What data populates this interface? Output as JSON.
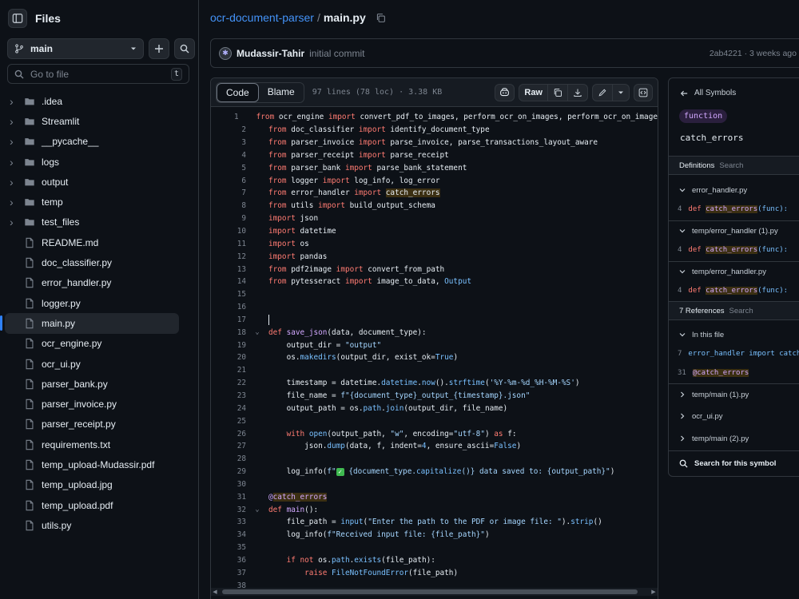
{
  "sidebar": {
    "title": "Files",
    "branch": "main",
    "goto_placeholder": "Go to file",
    "goto_kbd": "t",
    "items": [
      {
        "label": ".idea",
        "type": "folder"
      },
      {
        "label": "Streamlit",
        "type": "folder"
      },
      {
        "label": "__pycache__",
        "type": "folder"
      },
      {
        "label": "logs",
        "type": "folder"
      },
      {
        "label": "output",
        "type": "folder"
      },
      {
        "label": "temp",
        "type": "folder"
      },
      {
        "label": "test_files",
        "type": "folder"
      },
      {
        "label": "README.md",
        "type": "file"
      },
      {
        "label": "doc_classifier.py",
        "type": "file"
      },
      {
        "label": "error_handler.py",
        "type": "file"
      },
      {
        "label": "logger.py",
        "type": "file"
      },
      {
        "label": "main.py",
        "type": "file",
        "active": true
      },
      {
        "label": "ocr_engine.py",
        "type": "file"
      },
      {
        "label": "ocr_ui.py",
        "type": "file"
      },
      {
        "label": "parser_bank.py",
        "type": "file"
      },
      {
        "label": "parser_invoice.py",
        "type": "file"
      },
      {
        "label": "parser_receipt.py",
        "type": "file"
      },
      {
        "label": "requirements.txt",
        "type": "file"
      },
      {
        "label": "temp_upload-Mudassir.pdf",
        "type": "file"
      },
      {
        "label": "temp_upload.jpg",
        "type": "file"
      },
      {
        "label": "temp_upload.pdf",
        "type": "file"
      },
      {
        "label": "utils.py",
        "type": "file"
      }
    ]
  },
  "header": {
    "repo": "ocr-document-parser",
    "separator": "/",
    "file": "main.py"
  },
  "commit": {
    "author": "Mudassir-Tahir",
    "message": "initial commit",
    "sha_time": "2ab4221 · 3 weeks ago"
  },
  "code_toolbar": {
    "tab_code": "Code",
    "tab_blame": "Blame",
    "meta": "97 lines (78 loc) · 3.38 KB",
    "raw": "Raw"
  },
  "code_lines": [
    {
      "n": "1",
      "html": "<span class='kw'>from</span> ocr_engine <span class='kw'>import</span> convert_pdf_to_images, perform_ocr_on_images, perform_ocr_on_image"
    },
    {
      "n": "2",
      "html": "<span class='kw'>from</span> doc_classifier <span class='kw'>import</span> identify_document_type"
    },
    {
      "n": "3",
      "html": "<span class='kw'>from</span> parser_invoice <span class='kw'>import</span> parse_invoice, parse_transactions_layout_aware"
    },
    {
      "n": "4",
      "html": "<span class='kw'>from</span> parser_receipt <span class='kw'>import</span> parse_receipt"
    },
    {
      "n": "5",
      "html": "<span class='kw'>from</span> parser_bank <span class='kw'>import</span> parse_bank_statement"
    },
    {
      "n": "6",
      "html": "<span class='kw'>from</span> logger <span class='kw'>import</span> log_info, log_error"
    },
    {
      "n": "7",
      "html": "<span class='kw'>from</span> error_handler <span class='kw'>import</span> <span class='hl'>catch_errors</span>"
    },
    {
      "n": "8",
      "html": "<span class='kw'>from</span> utils <span class='kw'>import</span> build_output_schema"
    },
    {
      "n": "9",
      "html": "<span class='kw'>import</span> json"
    },
    {
      "n": "10",
      "html": "<span class='kw'>import</span> datetime"
    },
    {
      "n": "11",
      "html": "<span class='kw'>import</span> os"
    },
    {
      "n": "12",
      "html": "<span class='kw'>import</span> pandas"
    },
    {
      "n": "13",
      "html": "<span class='kw'>from</span> pdf2image <span class='kw'>import</span> convert_from_path"
    },
    {
      "n": "14",
      "html": "<span class='kw'>from</span> pytesseract <span class='kw'>import</span> image_to_data, <span class='bi'>Output</span>"
    },
    {
      "n": "15",
      "html": ""
    },
    {
      "n": "16",
      "html": ""
    },
    {
      "n": "17",
      "html": "<span class='caret'></span>"
    },
    {
      "n": "18",
      "fold": true,
      "html": "<span class='kw'>def</span> <span class='fn'>save_json</span>(data, document_type):"
    },
    {
      "n": "19",
      "html": "    output_dir = <span class='str'>\"output\"</span>"
    },
    {
      "n": "20",
      "html": "    os.<span class='bi'>makedirs</span>(output_dir, exist_ok=<span class='bi'>True</span>)"
    },
    {
      "n": "21",
      "html": ""
    },
    {
      "n": "22",
      "html": "    timestamp = datetime.<span class='bi'>datetime</span>.<span class='bi'>now</span>().<span class='bi'>strftime</span>(<span class='str'>'%Y-%m-%d_%H-%M-%S'</span>)"
    },
    {
      "n": "23",
      "html": "    file_name = <span class='str'>f\"{document_type}_output_{timestamp}.json\"</span>"
    },
    {
      "n": "24",
      "html": "    output_path = os.<span class='bi'>path</span>.<span class='bi'>join</span>(output_dir, file_name)"
    },
    {
      "n": "25",
      "html": ""
    },
    {
      "n": "26",
      "html": "    <span class='kw'>with</span> <span class='bi'>open</span>(output_path, <span class='str'>\"w\"</span>, encoding=<span class='str'>\"utf-8\"</span>) <span class='kw'>as</span> f:"
    },
    {
      "n": "27",
      "html": "        json.<span class='bi'>dump</span>(data, f, indent=<span class='bi'>4</span>, ensure_ascii=<span class='bi'>False</span>)"
    },
    {
      "n": "28",
      "html": ""
    },
    {
      "n": "29",
      "html": "    log_info(<span class='str'>f\"<span class='emoji'>✓</span> {document_type.<span class='bi'>capitalize</span>()} data saved to: {output_path}\"</span>)"
    },
    {
      "n": "30",
      "html": ""
    },
    {
      "n": "31",
      "html": "<span class='fn'>@<span class='hl'>catch_errors</span></span>"
    },
    {
      "n": "32",
      "fold": true,
      "html": "<span class='kw'>def</span> <span class='fn'>main</span>():"
    },
    {
      "n": "33",
      "html": "    file_path = <span class='bi'>input</span>(<span class='str'>\"Enter the path to the PDF or image file: \"</span>).<span class='bi'>strip</span>()"
    },
    {
      "n": "34",
      "html": "    log_info(<span class='str'>f\"Received input file: {file_path}\"</span>)"
    },
    {
      "n": "35",
      "html": ""
    },
    {
      "n": "36",
      "html": "    <span class='kw'>if not</span> os.<span class='bi'>path</span>.<span class='bi'>exists</span>(file_path):"
    },
    {
      "n": "37",
      "html": "        <span class='kw'>raise</span> <span class='bi'>FileNotFoundError</span>(file_path)"
    },
    {
      "n": "38",
      "html": ""
    }
  ],
  "symbols": {
    "back": "All Symbols",
    "kind": "function",
    "name": "catch_errors",
    "definitions_label": "Definitions",
    "search": "Search",
    "def_groups": [
      {
        "file": "error_handler.py",
        "num": "4",
        "kw": "def",
        "name": "catch_errors",
        "rest": "(func):"
      },
      {
        "file": "temp/error_handler (1).py",
        "num": "4",
        "kw": "def",
        "name": "catch_errors",
        "rest": "(func):"
      },
      {
        "file": "temp/error_handler.py",
        "num": "4",
        "kw": "def",
        "name": "catch_errors",
        "rest": "(func):"
      }
    ],
    "references_label": "7 References",
    "in_this_file": "In this file",
    "refs": [
      {
        "num": "7",
        "text": "error_handler import catch_"
      },
      {
        "num": "31",
        "text": "@catch_errors"
      }
    ],
    "ref_groups": [
      "temp/main (1).py",
      "ocr_ui.py",
      "temp/main (2).py"
    ],
    "search_symbol": "Search for this symbol"
  }
}
